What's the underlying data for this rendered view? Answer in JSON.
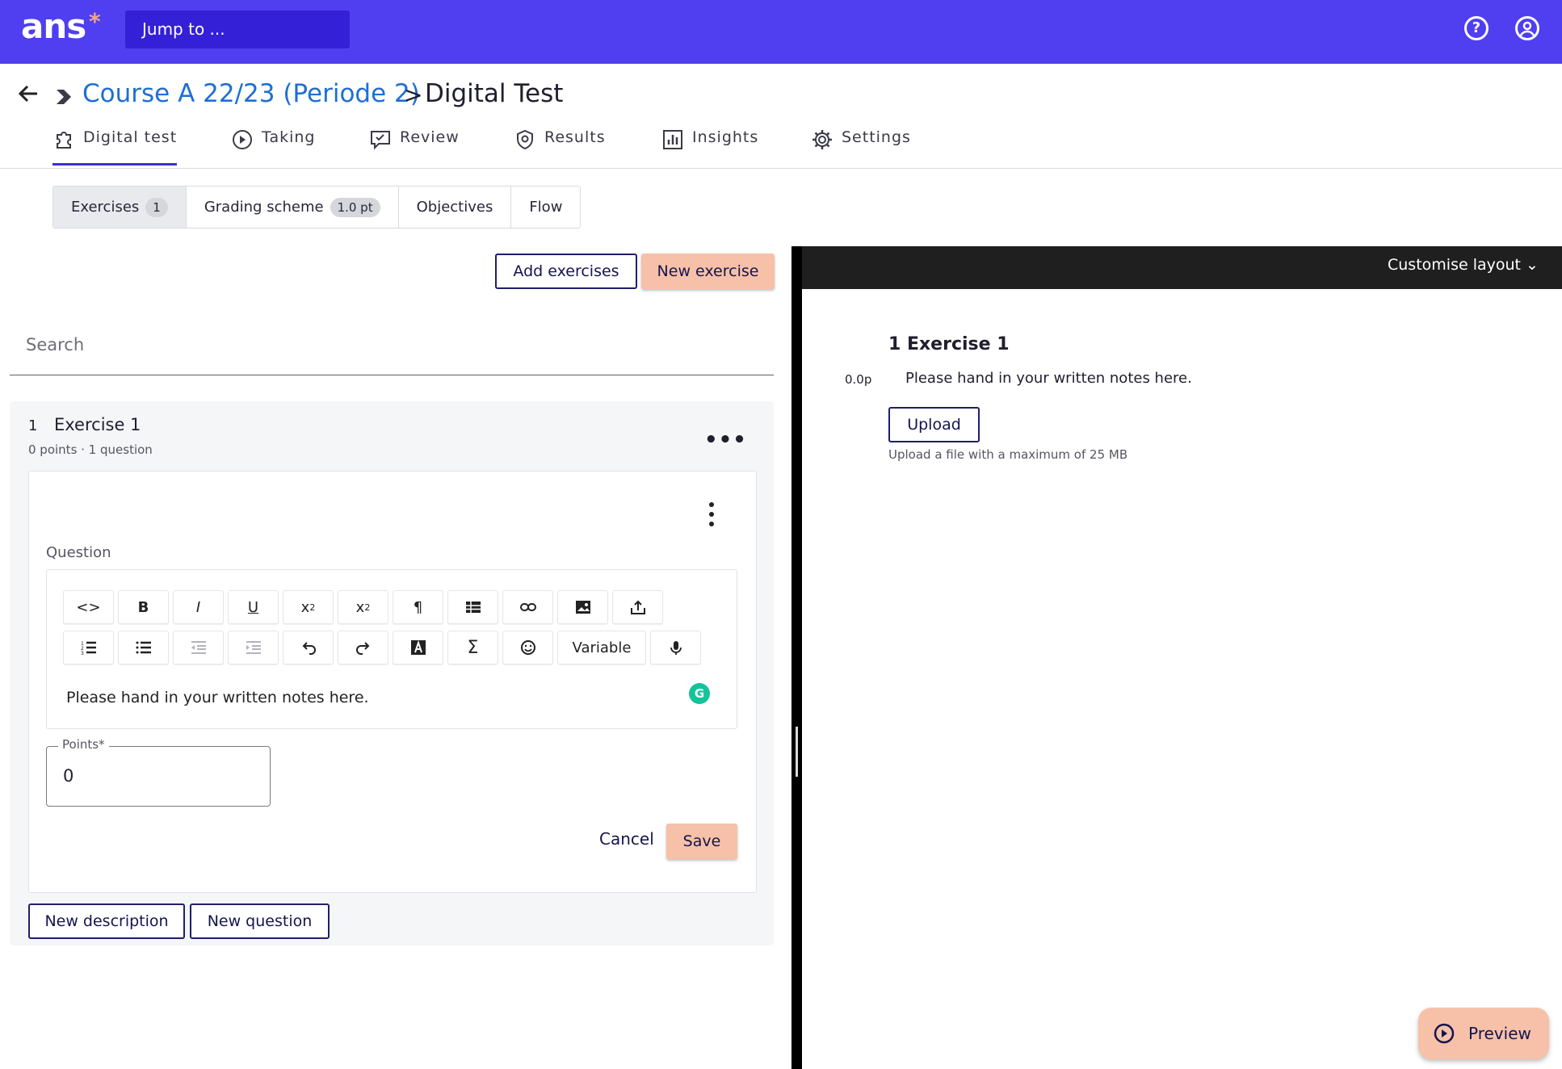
{
  "topbar": {
    "logo": "ans",
    "logo_mark": "*",
    "jump_placeholder": "Jump to ...",
    "help_icon": "help-circle-icon",
    "account_icon": "user-circle-icon"
  },
  "breadcrumb": {
    "course": "Course A 22/23 (Periode 2)",
    "separator": ">",
    "current": "Digital Test"
  },
  "nav": {
    "tabs": [
      {
        "label": "Digital test",
        "icon": "puzzle-icon",
        "active": true
      },
      {
        "label": "Taking",
        "icon": "play-circle-icon"
      },
      {
        "label": "Review",
        "icon": "comment-check-icon"
      },
      {
        "label": "Results",
        "icon": "shield-check-icon"
      },
      {
        "label": "Insights",
        "icon": "bar-chart-icon"
      },
      {
        "label": "Settings",
        "icon": "gear-icon"
      }
    ]
  },
  "subtabs": [
    {
      "label": "Exercises",
      "badge": "1",
      "selected": true
    },
    {
      "label": "Grading scheme",
      "badge": "1.0 pt"
    },
    {
      "label": "Objectives"
    },
    {
      "label": "Flow"
    }
  ],
  "actions": {
    "add_exercises": "Add exercises",
    "new_exercise": "New exercise"
  },
  "search": {
    "placeholder": "Search"
  },
  "exercise": {
    "number": "1",
    "title": "Exercise 1",
    "meta": "0 points · 1 question"
  },
  "question": {
    "label": "Question",
    "toolbar_row2_variable": "Variable",
    "text": "Please hand in your written notes here.",
    "points_label": "Points*",
    "points_value": "0",
    "cancel": "Cancel",
    "save": "Save"
  },
  "bottom_actions": {
    "new_description": "New description",
    "new_question": "New question"
  },
  "preview_panel": {
    "customise": "Customise layout ⌄",
    "exercise_title": "1 Exercise 1",
    "points": "0.0p",
    "question_text": "Please hand in your written notes here.",
    "upload": "Upload",
    "upload_hint": "Upload a file with a maximum of 25 MB"
  },
  "preview_button": "Preview",
  "colors": {
    "brand": "#4f3ff0",
    "link": "#1f6fd1",
    "accent_button": "#f6c1a8",
    "dark": "#14144f"
  }
}
